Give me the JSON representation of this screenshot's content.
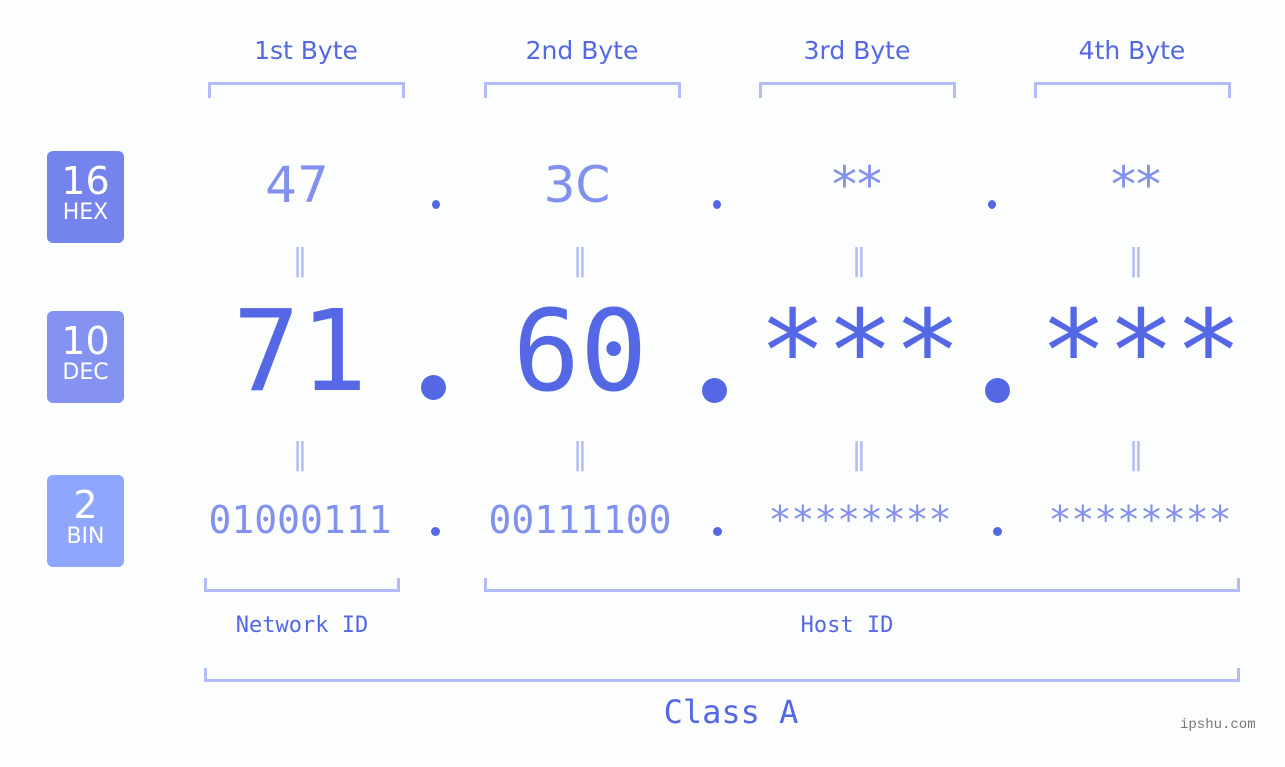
{
  "diagram": {
    "type": "ipv4-address-breakdown",
    "byte_headers": [
      "1st Byte",
      "2nd Byte",
      "3rd Byte",
      "4th Byte"
    ],
    "bases": [
      {
        "radix": "16",
        "label": "HEX",
        "color": "#7583ec"
      },
      {
        "radix": "10",
        "label": "DEC",
        "color": "#8493f2"
      },
      {
        "radix": "2",
        "label": "BIN",
        "color": "#8ea6fb"
      }
    ],
    "hex_values": [
      "47",
      "3C",
      "**",
      "**"
    ],
    "dec_values": [
      "71",
      "60",
      "***",
      "***"
    ],
    "bin_values": [
      "01000111",
      "00111100",
      "********",
      "********"
    ],
    "separator": ".",
    "equals_symbol": "=",
    "network_id_label": "Network ID",
    "host_id_label": "Host ID",
    "class_label": "Class A",
    "watermark": "ipshu.com",
    "colors": {
      "accent": "#5468e6",
      "secondary": "#8290ef",
      "bracket": "#b3bcf7",
      "background": "#fcfdfd"
    }
  }
}
